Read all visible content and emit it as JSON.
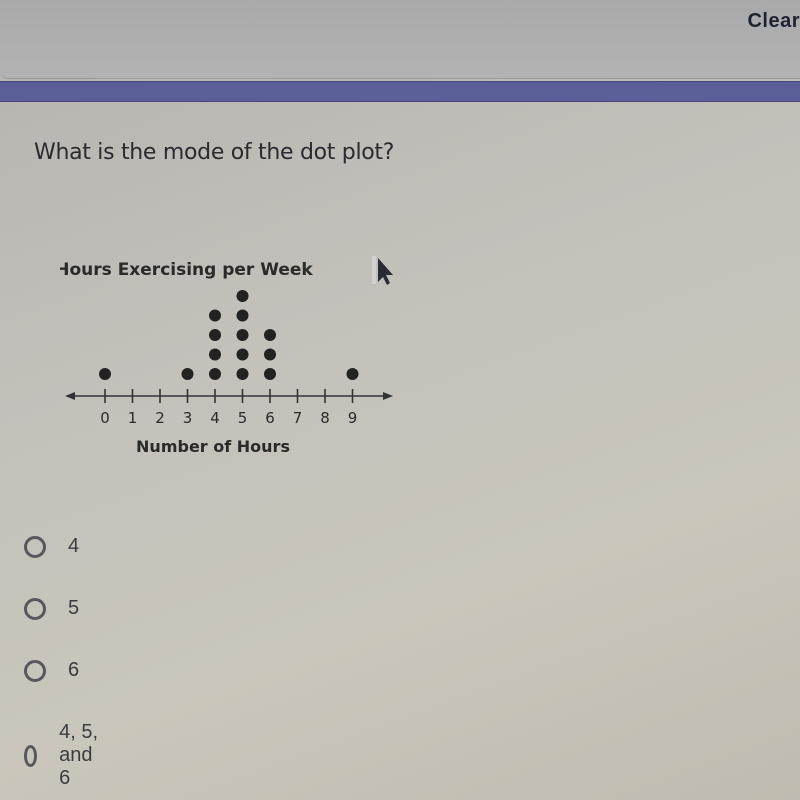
{
  "header": {
    "clear_label": "Clear"
  },
  "colors": {
    "accent_bar": "#5a5f98",
    "dot": "#222222"
  },
  "question": {
    "text": "What is the mode of the dot plot?"
  },
  "chart_data": {
    "type": "scatter",
    "subtype": "dot_plot",
    "title": "Hours Exercising per Week",
    "xlabel": "Number of Hours",
    "ylabel": "",
    "x_ticks": [
      0,
      1,
      2,
      3,
      4,
      5,
      6,
      7,
      8,
      9
    ],
    "xlim": [
      0,
      9
    ],
    "counts": [
      {
        "x": 0,
        "count": 1
      },
      {
        "x": 3,
        "count": 1
      },
      {
        "x": 4,
        "count": 4
      },
      {
        "x": 5,
        "count": 5
      },
      {
        "x": 6,
        "count": 3
      },
      {
        "x": 9,
        "count": 1
      }
    ],
    "grid": false
  },
  "options": [
    {
      "label": "4",
      "selected": false
    },
    {
      "label": "5",
      "selected": false
    },
    {
      "label": "6",
      "selected": false
    },
    {
      "label": "4, 5, and 6",
      "selected": false
    }
  ]
}
